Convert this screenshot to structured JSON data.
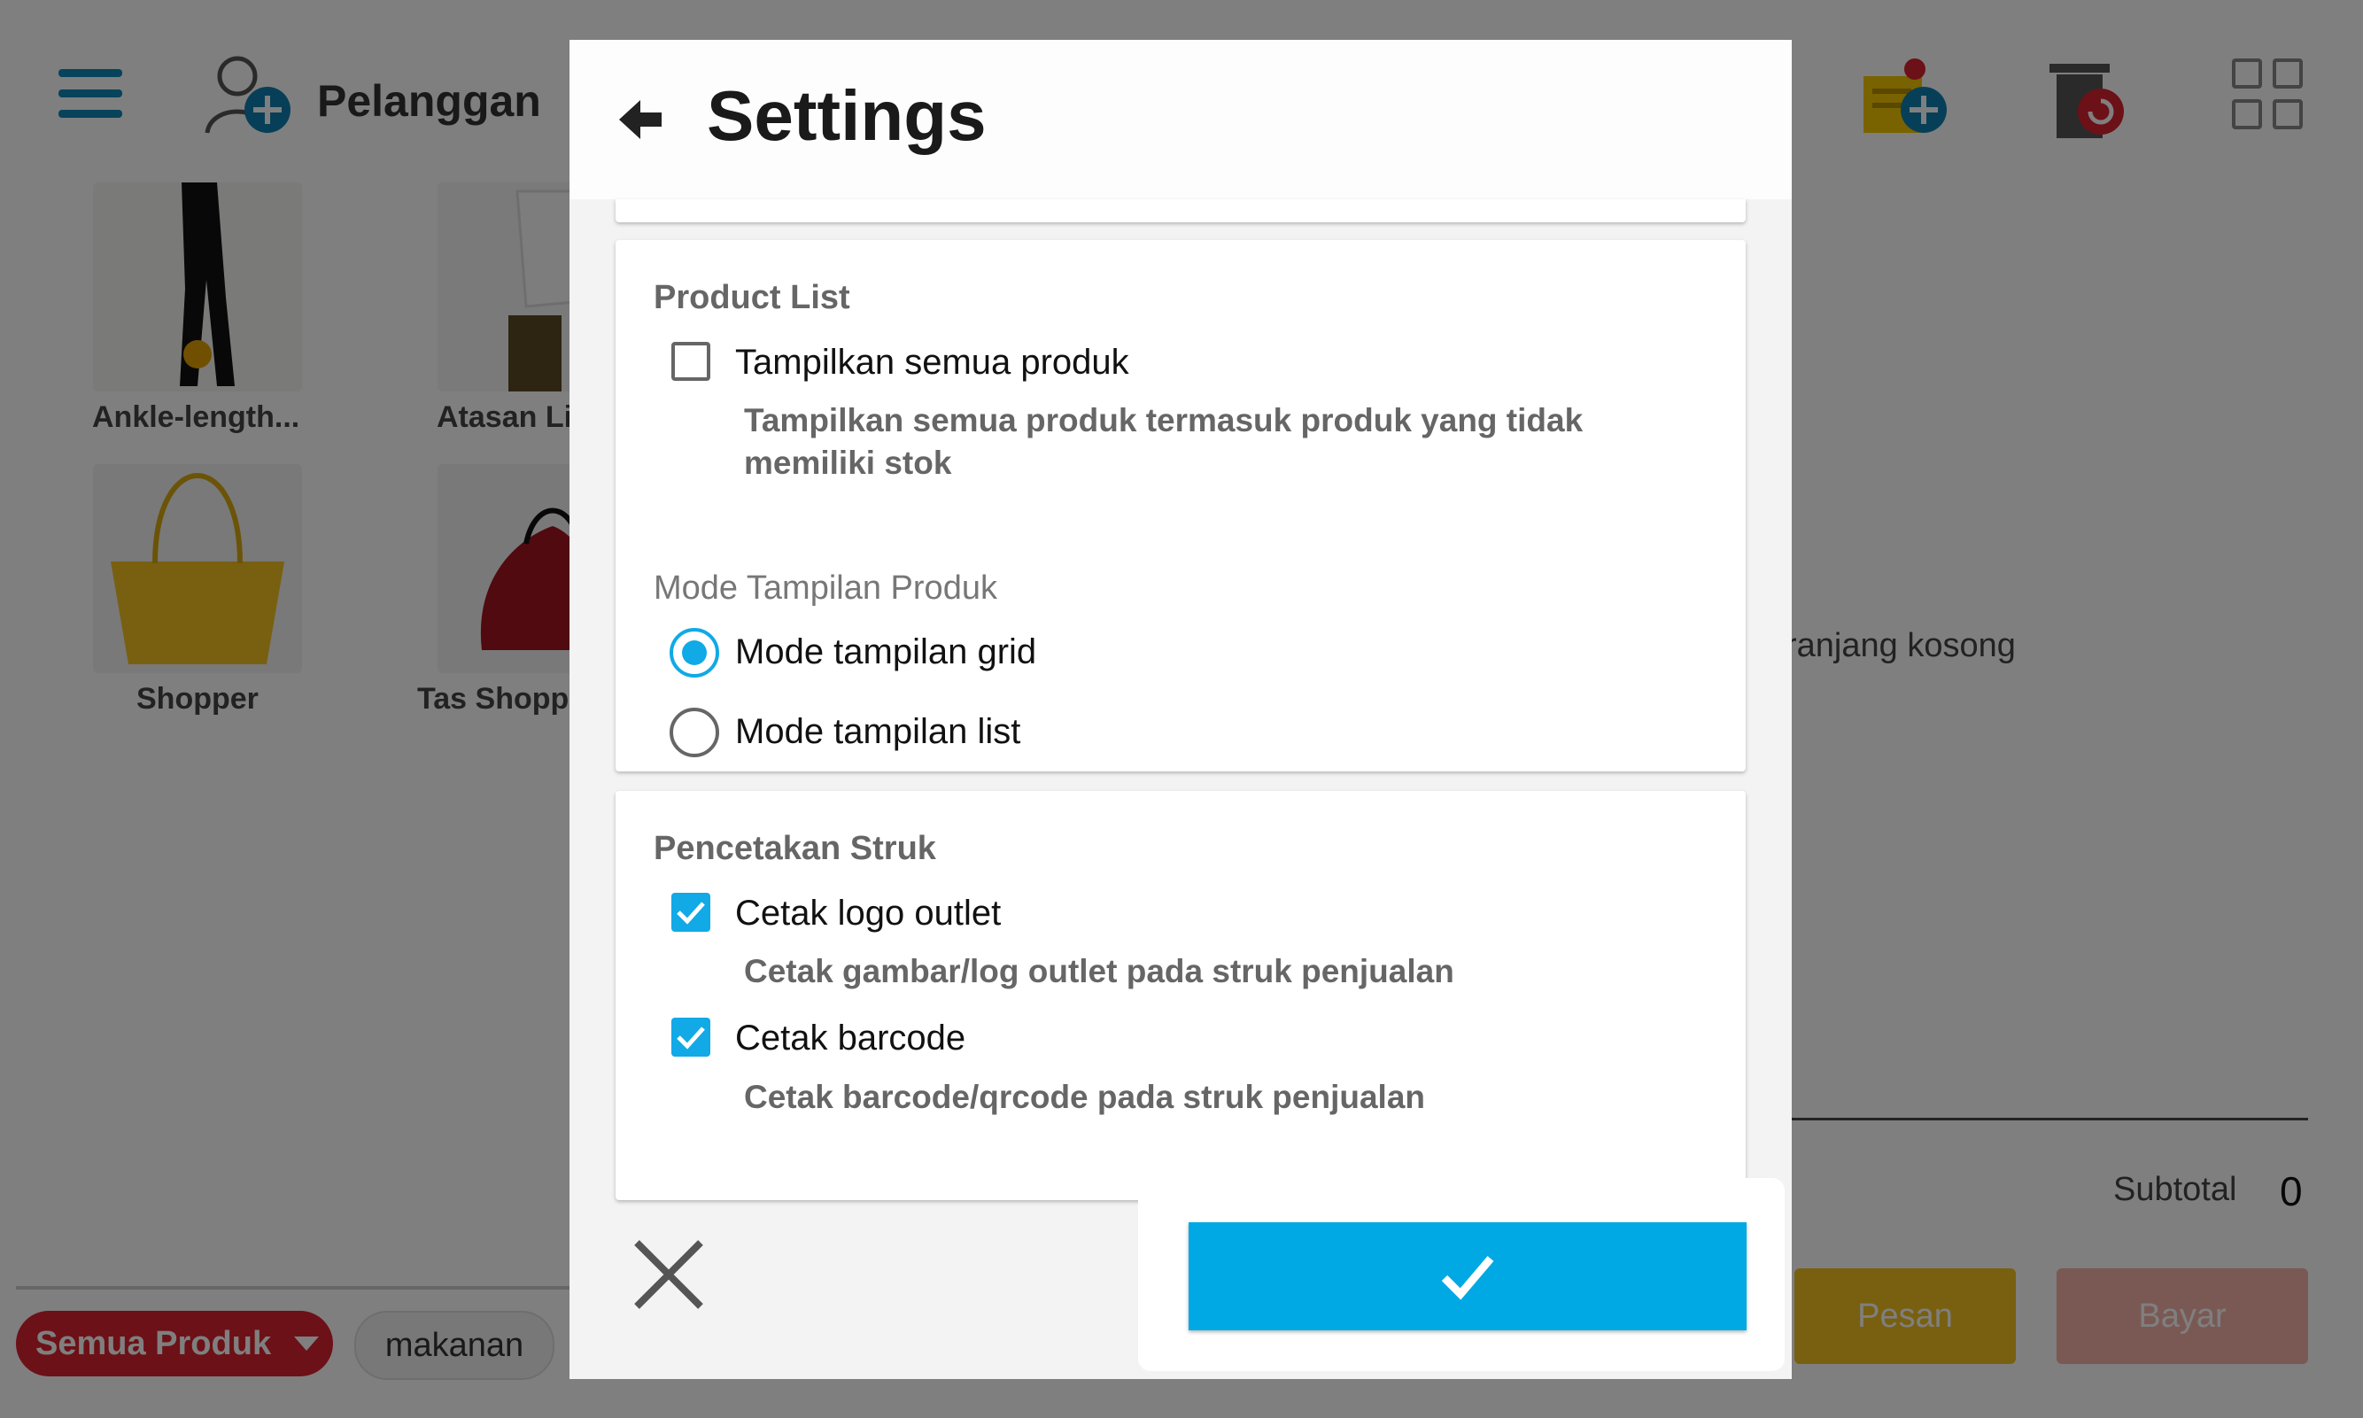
{
  "header": {
    "customer_label": "Pelanggan"
  },
  "products": [
    {
      "name": "Ankle-length..."
    },
    {
      "name": "Atasan Li"
    },
    {
      "name": "Shopper"
    },
    {
      "name": "Tas Shopp"
    }
  ],
  "categories": {
    "all_label": "Semua Produk",
    "food_label": "makanan"
  },
  "cart": {
    "empty_text": "ranjang kosong",
    "subtotal_label": "Subtotal",
    "subtotal_value": "0",
    "order_label": "Pesan",
    "pay_label": "Bayar"
  },
  "dialog": {
    "title": "Settings",
    "product_list": {
      "title": "Product List",
      "show_all": {
        "label": "Tampilkan semua produk",
        "desc": "Tampilkan semua produk termasuk produk yang tidak memiliki stok",
        "checked": false
      },
      "mode_title": "Mode Tampilan Produk",
      "modes": [
        {
          "label": "Mode tampilan grid",
          "selected": true
        },
        {
          "label": "Mode tampilan list",
          "selected": false
        }
      ]
    },
    "receipt": {
      "title": "Pencetakan Struk",
      "print_logo": {
        "label": "Cetak logo outlet",
        "desc": "Cetak gambar/log outlet pada struk penjualan",
        "checked": true
      },
      "print_barcode": {
        "label": "Cetak barcode",
        "desc": "Cetak barcode/qrcode pada struk penjualan",
        "checked": true
      }
    }
  },
  "colors": {
    "accent": "#00a9e3",
    "category_active": "#d9232e"
  },
  "icons": {
    "menu": "hamburger-menu-icon",
    "add_customer": "add-customer-icon",
    "add_note": "add-note-icon",
    "restore_trash": "restore-trash-icon",
    "grid": "grid-view-icon",
    "back": "back-arrow-icon",
    "close": "close-icon",
    "check": "check-icon"
  }
}
